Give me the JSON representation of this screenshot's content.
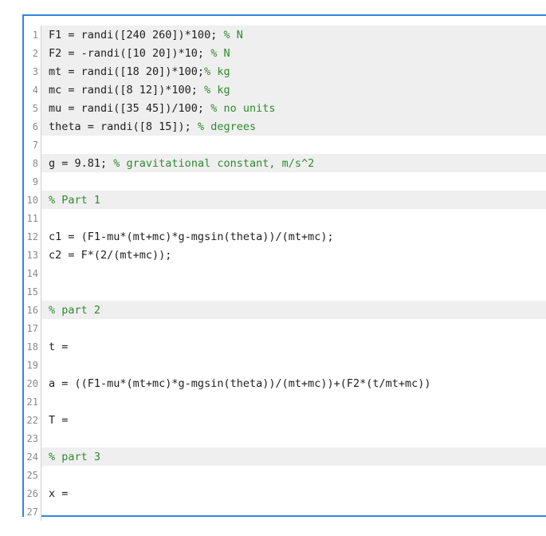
{
  "lines": [
    {
      "num": "1",
      "code": "F1 = randi([240 260])*100; ",
      "comment": "% N",
      "shaded": true
    },
    {
      "num": "2",
      "code": "F2 = -randi([10 20])*10; ",
      "comment": "% N",
      "shaded": true
    },
    {
      "num": "3",
      "code": "mt = randi([18 20])*100;",
      "comment": "% kg",
      "shaded": true
    },
    {
      "num": "4",
      "code": "mc = randi([8 12])*100; ",
      "comment": "% kg",
      "shaded": true
    },
    {
      "num": "5",
      "code": "mu = randi([35 45])/100; ",
      "comment": "% no units",
      "shaded": true
    },
    {
      "num": "6",
      "code": "theta = randi([8 15]); ",
      "comment": "% degrees",
      "shaded": true
    },
    {
      "num": "7",
      "code": "",
      "comment": "",
      "shaded": false
    },
    {
      "num": "8",
      "code": "g = 9.81; ",
      "comment": "% gravitational constant, m/s^2",
      "shaded": true
    },
    {
      "num": "9",
      "code": "",
      "comment": "",
      "shaded": false
    },
    {
      "num": "10",
      "code": "",
      "comment": "% Part 1",
      "shaded": true
    },
    {
      "num": "11",
      "code": "",
      "comment": "",
      "shaded": false
    },
    {
      "num": "12",
      "code": "c1 = (F1-mu*(mt+mc)*g-mgsin(theta))/(mt+mc);",
      "comment": "",
      "shaded": false
    },
    {
      "num": "13",
      "code": "c2 = F*(2/(mt+mc));",
      "comment": "",
      "shaded": false
    },
    {
      "num": "14",
      "code": "",
      "comment": "",
      "shaded": false
    },
    {
      "num": "15",
      "code": "",
      "comment": "",
      "shaded": false
    },
    {
      "num": "16",
      "code": "",
      "comment": "% part 2",
      "shaded": true
    },
    {
      "num": "17",
      "code": "",
      "comment": "",
      "shaded": false
    },
    {
      "num": "18",
      "code": "t =",
      "comment": "",
      "shaded": false
    },
    {
      "num": "19",
      "code": "",
      "comment": "",
      "shaded": false
    },
    {
      "num": "20",
      "code": "a = ((F1-mu*(mt+mc)*g-mgsin(theta))/(mt+mc))+(F2*(t/mt+mc))",
      "comment": "",
      "shaded": false
    },
    {
      "num": "21",
      "code": "",
      "comment": "",
      "shaded": false
    },
    {
      "num": "22",
      "code": "T =",
      "comment": "",
      "shaded": false
    },
    {
      "num": "23",
      "code": "",
      "comment": "",
      "shaded": false
    },
    {
      "num": "24",
      "code": "",
      "comment": "% part 3",
      "shaded": true
    },
    {
      "num": "25",
      "code": "",
      "comment": "",
      "shaded": false
    },
    {
      "num": "26",
      "code": "x =",
      "comment": "",
      "shaded": false
    },
    {
      "num": "27",
      "code": "",
      "comment": "",
      "shaded": false
    }
  ]
}
